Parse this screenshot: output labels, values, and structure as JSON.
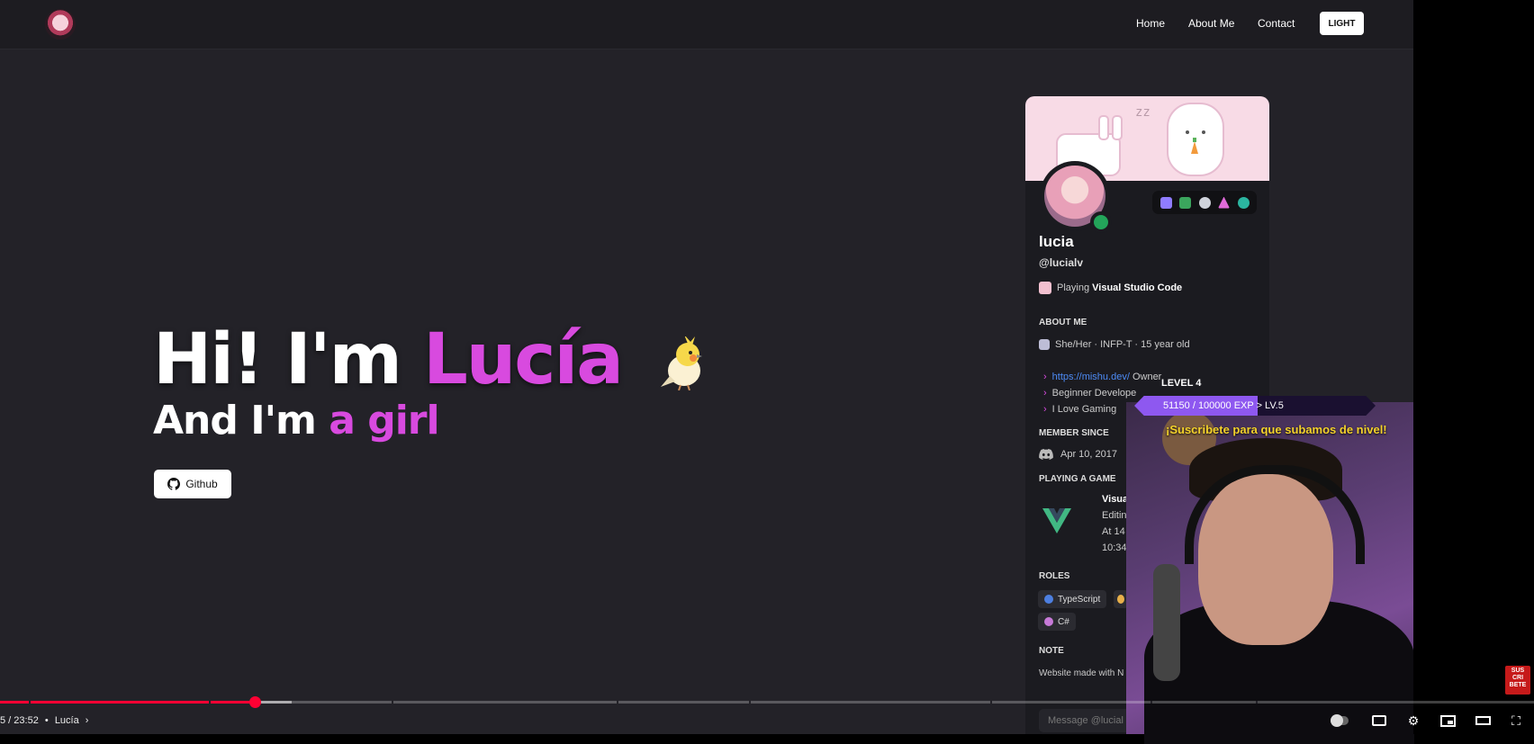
{
  "nav": {
    "links": [
      "Home",
      "About Me",
      "Contact"
    ],
    "theme_button": "LIGHT"
  },
  "hero": {
    "greeting": "Hi! I'm ",
    "name": "Lucía",
    "line2": "And I'm ",
    "line2_highlight": "a girl",
    "github_button": "Github",
    "accent_color": "#d84adf"
  },
  "profile": {
    "display_name": "lucia",
    "handle": "@lucialv",
    "playing_prefix": "Playing ",
    "playing_app": "Visual Studio Code",
    "about_title": "ABOUT ME",
    "about_line": "She/Her · INFP-T · 15 year old",
    "bullets": [
      {
        "link": "https://mishu.dev/",
        "text": " Owner"
      },
      {
        "text": "Beginner Develope"
      },
      {
        "text": "I Love Gaming"
      }
    ],
    "member_since_title": "MEMBER SINCE",
    "member_since": "Apr 10, 2017",
    "playing_game_title": "PLAYING A GAME",
    "game_lines": [
      "Visua",
      "Editin",
      "At 14",
      "10:34"
    ],
    "roles_title": "ROLES",
    "roles": [
      {
        "name": "TypeScript",
        "color": "#4d7fe0"
      },
      {
        "name": "C#",
        "color": "#c77ad8"
      }
    ],
    "note_title": "NOTE",
    "note": "Website made with N",
    "message_placeholder": "Message @lucial"
  },
  "stream_overlay": {
    "level": "LEVEL 4",
    "exp": "51150 / 100000 EXP",
    "next_level": "> LV.5",
    "exp_fraction": 0.5115,
    "subscribe_text": "¡Suscribete para que subamos de nivel!",
    "subscribe_logo": [
      "SUS",
      "CRI",
      "BETE"
    ]
  },
  "player": {
    "time": "5 / 23:52",
    "chapter": "Lucía",
    "played_fraction": 0.166,
    "buffered_fraction": 0.19,
    "icons": [
      "autoplay-toggle-icon",
      "subtitles-icon",
      "settings-icon",
      "miniplayer-icon",
      "theater-icon",
      "fullscreen-icon"
    ]
  }
}
